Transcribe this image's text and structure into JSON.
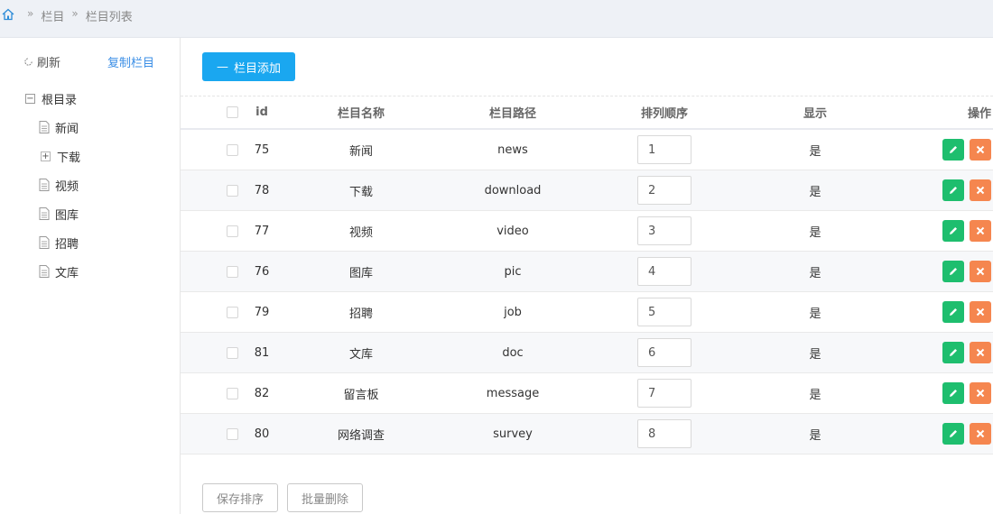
{
  "breadcrumb": {
    "items": [
      "栏目",
      "栏目列表"
    ],
    "sep": "»"
  },
  "tree": {
    "refresh_label": "刷新",
    "copy_label": "复制栏目",
    "root": "根目录",
    "root_toggle": "−",
    "children": [
      {
        "label": "新闻",
        "type": "doc"
      },
      {
        "label": "下载",
        "type": "folder",
        "toggle": "+"
      },
      {
        "label": "视频",
        "type": "doc"
      },
      {
        "label": "图库",
        "type": "doc"
      },
      {
        "label": "招聘",
        "type": "doc"
      },
      {
        "label": "文库",
        "type": "doc"
      }
    ]
  },
  "toolbar": {
    "add_label": "栏目添加",
    "add_prefix": "—"
  },
  "table": {
    "columns": [
      "id",
      "栏目名称",
      "栏目路径",
      "排列顺序",
      "显示",
      "操作"
    ],
    "rows": [
      {
        "id": "75",
        "name": "新闻",
        "path": "news",
        "order": "1",
        "show": "是"
      },
      {
        "id": "78",
        "name": "下载",
        "path": "download",
        "order": "2",
        "show": "是"
      },
      {
        "id": "77",
        "name": "视频",
        "path": "video",
        "order": "3",
        "show": "是"
      },
      {
        "id": "76",
        "name": "图库",
        "path": "pic",
        "order": "4",
        "show": "是"
      },
      {
        "id": "79",
        "name": "招聘",
        "path": "job",
        "order": "5",
        "show": "是"
      },
      {
        "id": "81",
        "name": "文库",
        "path": "doc",
        "order": "6",
        "show": "是"
      },
      {
        "id": "82",
        "name": "留言板",
        "path": "message",
        "order": "7",
        "show": "是"
      },
      {
        "id": "80",
        "name": "网络调查",
        "path": "survey",
        "order": "8",
        "show": "是"
      }
    ]
  },
  "footer": {
    "save_order_label": "保存排序",
    "batch_delete_label": "批量删除"
  },
  "colors": {
    "primary": "#1aa7f0",
    "edit": "#1ebe6e",
    "delete": "#f5864f"
  }
}
